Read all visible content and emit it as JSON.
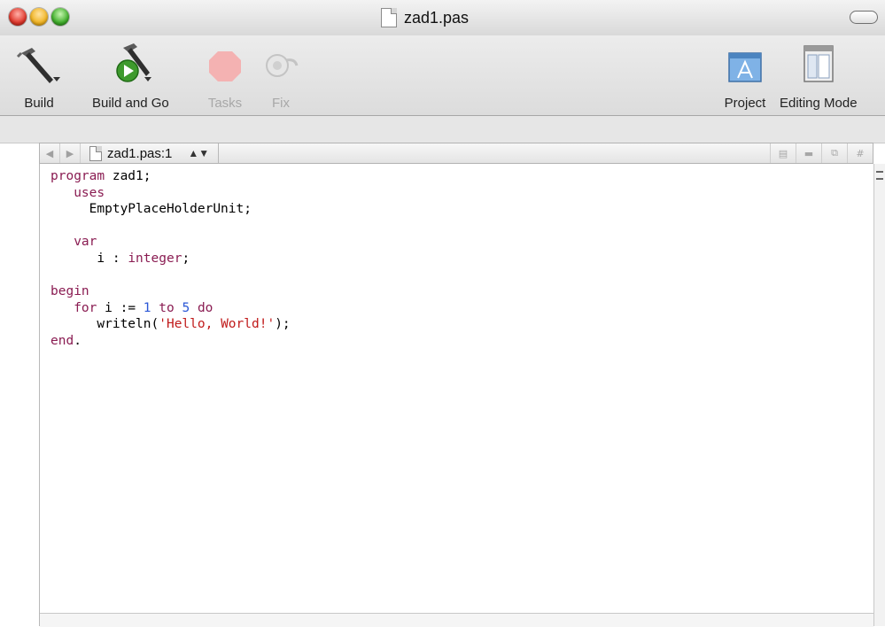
{
  "window": {
    "title": "zad1.pas"
  },
  "toolbar": {
    "build_label": "Build",
    "build_and_go_label": "Build and Go",
    "tasks_label": "Tasks",
    "fix_label": "Fix",
    "project_label": "Project",
    "editing_mode_label": "Editing Mode"
  },
  "navbar": {
    "file_location": "zad1.pas:1",
    "right_buttons": [
      "bookmarks",
      "breakpoints",
      "counterpart",
      "#"
    ]
  },
  "editor": {
    "language": "Pascal",
    "lines": [
      "program zad1;",
      "   uses",
      "     EmptyPlaceHolderUnit;",
      "",
      "   var",
      "      i : integer;",
      "",
      "begin",
      "   for i := 1 to 5 do",
      "      writeln('Hello, World!');",
      "end."
    ]
  },
  "colors": {
    "keyword": "#8a1c52",
    "number": "#2b57d6",
    "string": "#c01a1a"
  }
}
